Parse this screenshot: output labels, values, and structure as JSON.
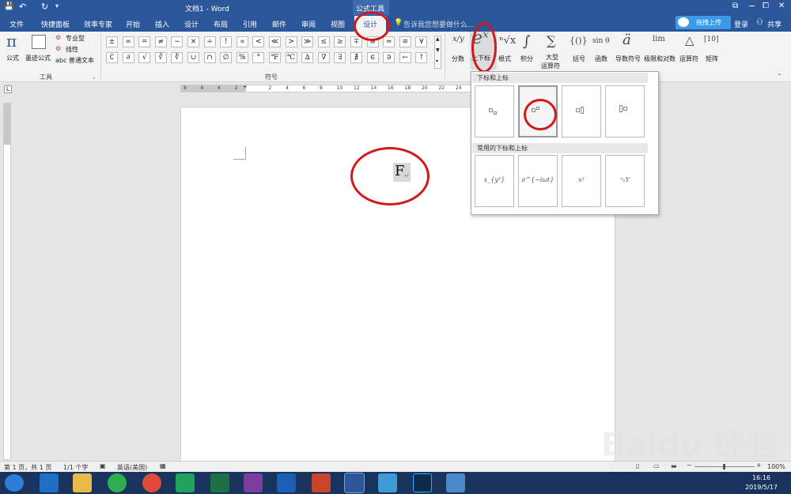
{
  "titlebar": {
    "doc_title": "文档1 - Word",
    "context_tool": "公式工具",
    "qat_save": "💾",
    "qat_undo": "↶",
    "qat_redo": "↻",
    "win_restore": "⧉",
    "win_min": "−",
    "win_max": "⧠",
    "win_close": "✕"
  },
  "tabs": [
    "文件",
    "快捷面板",
    "效率专家",
    "开始",
    "插入",
    "设计",
    "布局",
    "引用",
    "邮件",
    "审阅",
    "视图",
    "设计"
  ],
  "tellme": "告诉我您想要做什么...",
  "upload_label": "拖拽上传",
  "login_label": "登录",
  "share_label": "共享",
  "ribbon": {
    "formula_label": "公式",
    "ink_formula_label": "墨迹公式",
    "professional_label": "专业型",
    "linear_label": "线性",
    "normal_text_label": "abc 普通文本",
    "tools_group": "工具",
    "symbols_group": "符号",
    "symbols_row1": [
      "±",
      "∞",
      "=",
      "≠",
      "~",
      "×",
      "÷",
      "!",
      "∝",
      "<",
      "≪",
      ">",
      "≫",
      "≤",
      "≥",
      "∓",
      "≅",
      "≈",
      "≡",
      "∀"
    ],
    "symbols_row2": [
      "∁",
      "∂",
      "√",
      "∛",
      "∜",
      "∪",
      "∩",
      "∅",
      "%",
      "°",
      "℉",
      "℃",
      "∆",
      "∇",
      "∃",
      "∄",
      "∈",
      "∋",
      "←",
      "↑"
    ],
    "fraction_label": "分数",
    "fraction_icon": "x/y",
    "script_label": "上下标",
    "script_icon": "eˣ",
    "radical_label": "根式",
    "radical_icon": "ⁿ√x",
    "integral_label": "积分",
    "integral_icon": "∫",
    "large_op_label1": "大型",
    "large_op_label2": "运算符",
    "large_op_icon": "∑",
    "bracket_label": "括号",
    "bracket_icon": "{()}",
    "function_label": "函数",
    "function_icon": "sin θ",
    "accent_label": "导数符号",
    "accent_icon": "ä",
    "limit_label": "极限和对数",
    "limit_icon": "lim",
    "operator_label": "运算符",
    "operator_icon": "△",
    "matrix_label": "矩阵",
    "matrix_icon": "[10]"
  },
  "ruler_numbers": [
    "8",
    "6",
    "4",
    "2",
    "",
    "2",
    "4",
    "6",
    "8",
    "10",
    "12",
    "14",
    "16",
    "18",
    "20",
    "22",
    "24",
    "26",
    "28"
  ],
  "document": {
    "equation_char": "F",
    "paragraph_mark": "↵"
  },
  "dropdown": {
    "section1": "下标和上标",
    "section2": "常用的下标和上标",
    "common": [
      "x_{y²}",
      "e^{−iωt}",
      "x²",
      "ⁿ₁Y"
    ]
  },
  "status": {
    "page": "第 1 页，共 1 页",
    "words": "1/1 个字",
    "lang": "英语(美国)",
    "zoom": "100%"
  },
  "taskbar": {
    "time": "16:16",
    "date": "2019/5/17"
  },
  "watermark": {
    "text": "Baidu 经验",
    "url": "jingyan.baidu.com"
  },
  "colors": {
    "word_blue": "#2b579a",
    "annotation_red": "#d21818",
    "taskbar": "#19345c"
  }
}
